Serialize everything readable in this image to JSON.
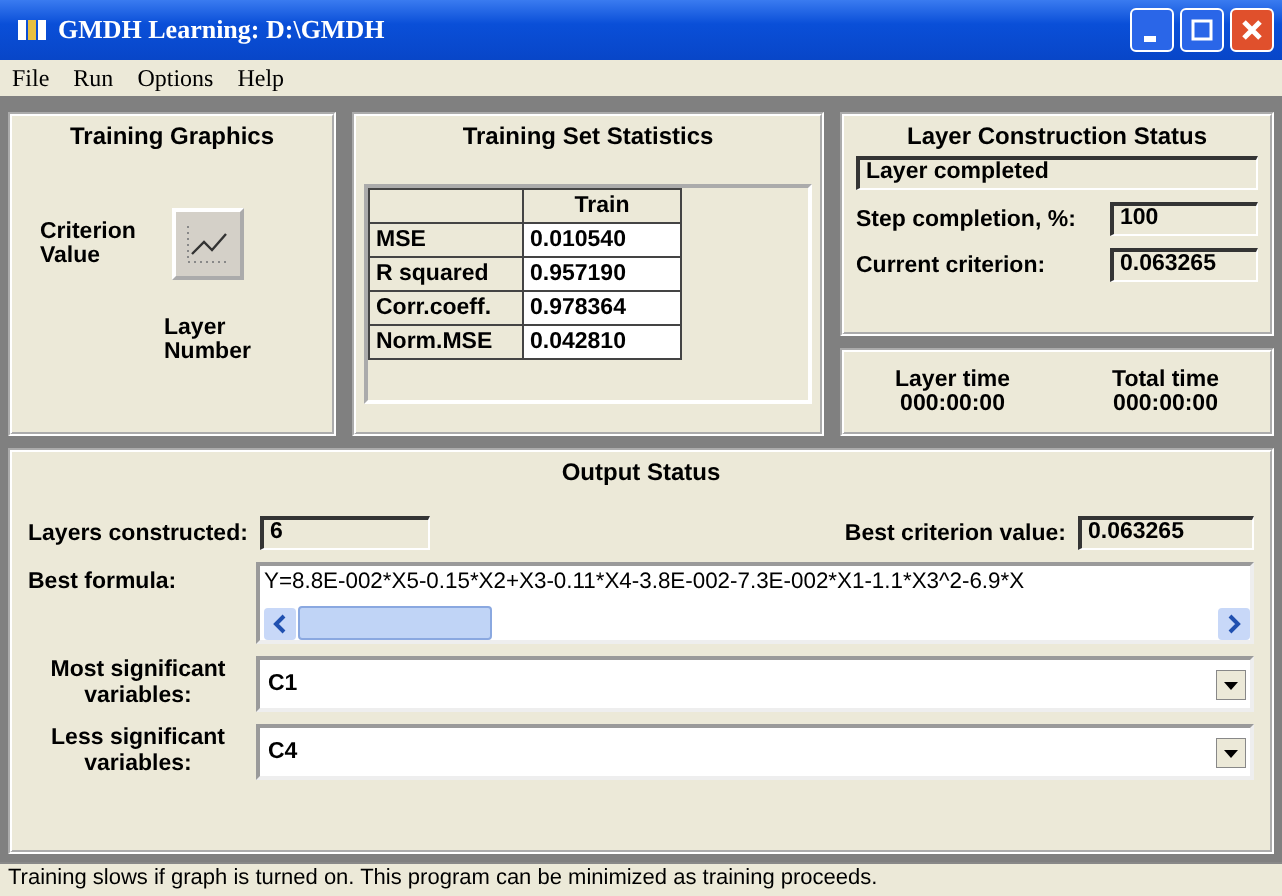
{
  "window": {
    "title": "GMDH Learning: D:\\GMDH"
  },
  "menu": [
    "File",
    "Run",
    "Options",
    "Help"
  ],
  "training_graphics": {
    "title": "Training Graphics",
    "y_label": "Criterion Value",
    "x_label": "Layer Number"
  },
  "statistics": {
    "title": "Training Set Statistics",
    "columns": [
      "",
      "Train"
    ],
    "rows": [
      {
        "name": "MSE",
        "train": "0.010540"
      },
      {
        "name": "R squared",
        "train": "0.957190"
      },
      {
        "name": "Corr.coeff.",
        "train": "0.978364"
      },
      {
        "name": "Norm.MSE",
        "train": "0.042810"
      }
    ]
  },
  "layer_status": {
    "title": "Layer Construction Status",
    "status": "Layer completed",
    "step_label": "Step completion, %:",
    "step_value": "100",
    "criterion_label": "Current criterion:",
    "criterion_value": "0.063265"
  },
  "times": [
    {
      "label": "Layer time",
      "value": "000:00:00"
    },
    {
      "label": "Total time",
      "value": "000:00:00"
    }
  ],
  "output": {
    "title": "Output Status",
    "layers_label": "Layers constructed:",
    "layers_value": "6",
    "best_label": "Best criterion value:",
    "best_value": "0.063265",
    "formula_label": "Best formula:",
    "formula": "Y=8.8E-002*X5-0.15*X2+X3-0.11*X4-3.8E-002-7.3E-002*X1-1.1*X3^2-6.9*X",
    "dropdowns": [
      {
        "label": "Most significant variables:",
        "value": "C1"
      },
      {
        "label": "Less significant variables:",
        "value": "C4"
      }
    ]
  },
  "status_bar": "Training slows if graph is turned on. This program can be minimized as training proceeds."
}
